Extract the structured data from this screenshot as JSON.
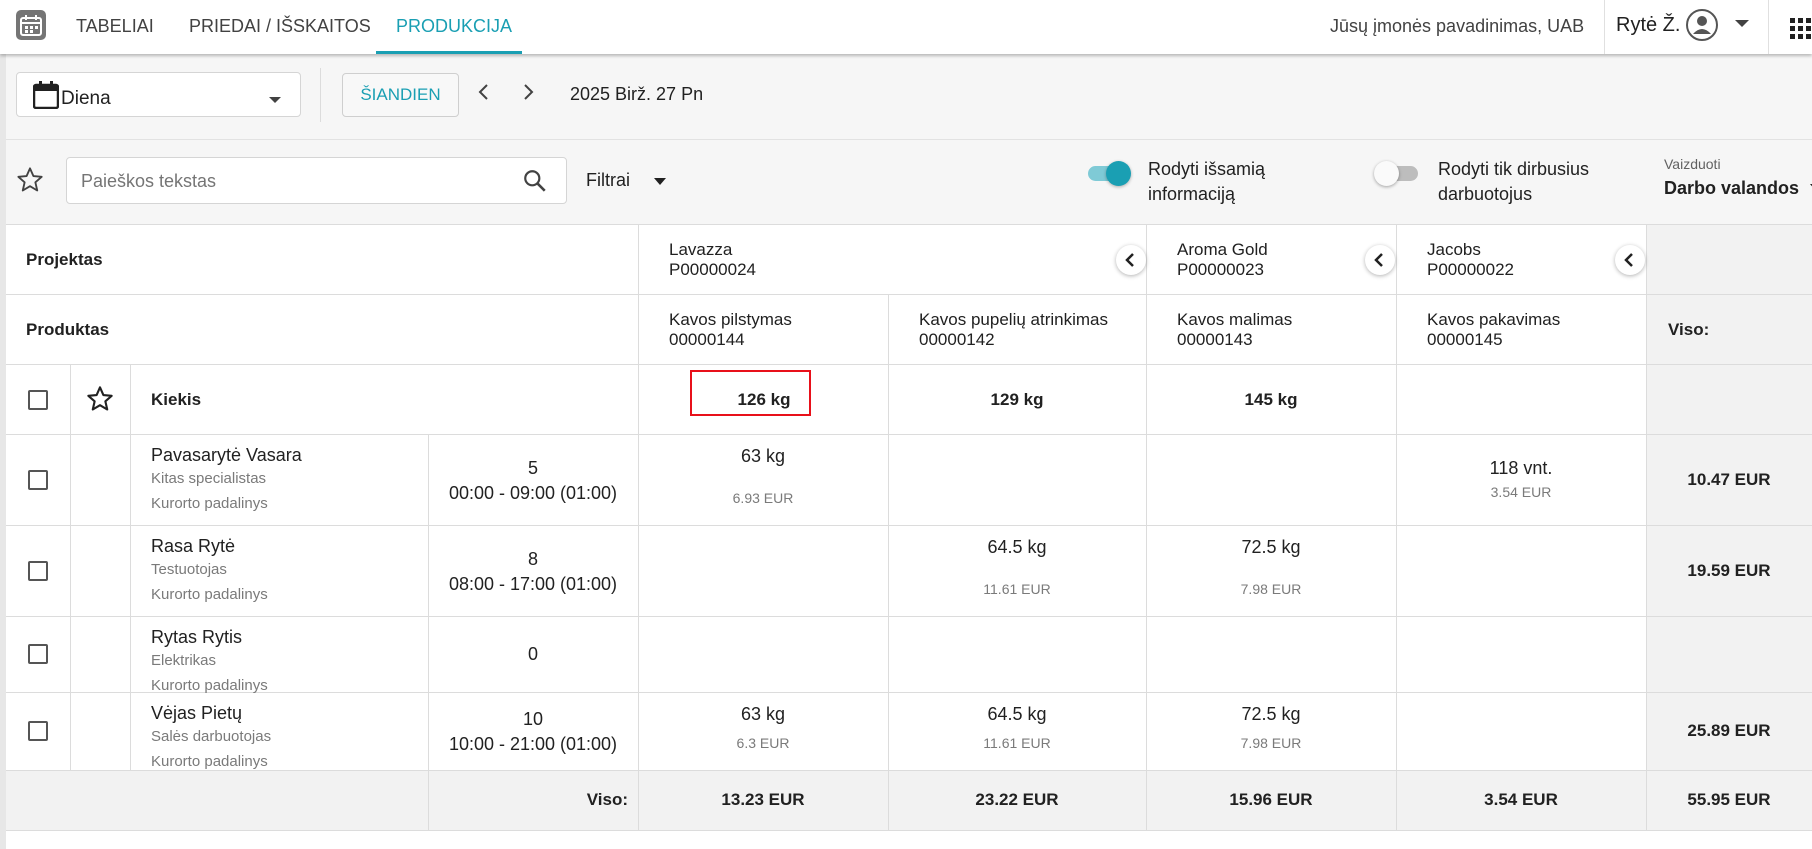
{
  "nav": {
    "tabs": [
      {
        "label": "TABELIAI"
      },
      {
        "label": "PRIEDAI / IŠSKAITOS"
      },
      {
        "label": "PRODUKCIJA"
      }
    ],
    "company": "Jūsų įmonės pavadinimas, UAB",
    "user": "Rytė Ž."
  },
  "toolbar": {
    "view_select": "Diena",
    "today_label": "ŠIANDIEN",
    "date": "2025 Birž. 27 Pn"
  },
  "filters": {
    "search_placeholder": "Paieškos tekstas",
    "filters_label": "Filtrai",
    "toggle_details_label_1": "Rodyti išsamią",
    "toggle_details_label_2": "informaciją",
    "toggle_worked_label_1": "Rodyti tik dirbusius",
    "toggle_worked_label_2": "darbuotojus",
    "display_label": "Vaizduoti",
    "display_value": "Darbo valandos"
  },
  "table": {
    "project_header": "Projektas",
    "product_header": "Produktas",
    "total_header": "Viso:",
    "quantity_label": "Kiekis",
    "projects": [
      {
        "name": "Lavazza",
        "code": "P00000024"
      },
      {
        "name": "Aroma Gold",
        "code": "P00000023"
      },
      {
        "name": "Jacobs",
        "code": "P00000022"
      }
    ],
    "products": [
      {
        "name": "Kavos pilstymas",
        "code": "00000144"
      },
      {
        "name": "Kavos pupelių atrinkimas",
        "code": "00000142"
      },
      {
        "name": "Kavos malimas",
        "code": "00000143"
      },
      {
        "name": "Kavos pakavimas",
        "code": "00000145"
      }
    ],
    "quantities": [
      "126 kg",
      "129 kg",
      "145 kg",
      ""
    ],
    "rows": [
      {
        "name": "Pavasarytė Vasara",
        "role": "Kitas specialistas",
        "unit": "Kurorto padalinys",
        "hours": "5",
        "time": "00:00 - 09:00 (01:00)",
        "c1": "63 kg",
        "c1e": "6.93 EUR",
        "c2": "",
        "c2e": "",
        "c3": "",
        "c3e": "",
        "c4": "118 vnt.",
        "c4e": "3.54 EUR",
        "total": "10.47 EUR"
      },
      {
        "name": "Rasa Rytė",
        "role": "Testuotojas",
        "unit": "Kurorto padalinys",
        "hours": "8",
        "time": "08:00 - 17:00 (01:00)",
        "c1": "",
        "c1e": "",
        "c2": "64.5 kg",
        "c2e": "11.61 EUR",
        "c3": "72.5 kg",
        "c3e": "7.98 EUR",
        "c4": "",
        "c4e": "",
        "total": "19.59 EUR"
      },
      {
        "name": "Rytas Rytis",
        "role": "Elektrikas",
        "unit": "Kurorto padalinys",
        "hours": "0",
        "time": "",
        "c1": "",
        "c1e": "",
        "c2": "",
        "c2e": "",
        "c3": "",
        "c3e": "",
        "c4": "",
        "c4e": "",
        "total": ""
      },
      {
        "name": "Vėjas Pietų",
        "role": "Salės darbuotojas",
        "unit": "Kurorto padalinys",
        "hours": "10",
        "time": "10:00 - 21:00 (01:00)",
        "c1": "63 kg",
        "c1e": "6.3 EUR",
        "c2": "64.5 kg",
        "c2e": "11.61 EUR",
        "c3": "72.5 kg",
        "c3e": "7.98 EUR",
        "c4": "",
        "c4e": "",
        "total": "25.89 EUR"
      }
    ],
    "footer": {
      "label": "Viso:",
      "totals": [
        "13.23 EUR",
        "23.22 EUR",
        "15.96 EUR",
        "3.54 EUR",
        "55.95 EUR"
      ]
    }
  }
}
